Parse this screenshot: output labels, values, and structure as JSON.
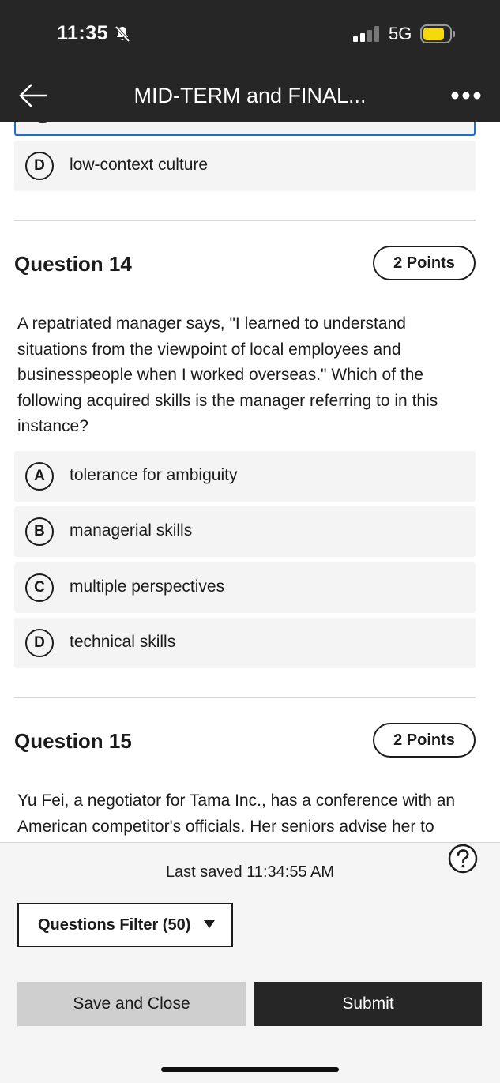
{
  "status_bar": {
    "time": "11:35",
    "network": "5G",
    "battery_color": "#f5d90a"
  },
  "header": {
    "title": "MID-TERM and FINAL...",
    "back_icon": "back-arrow-icon",
    "more_icon": "more-dots-icon"
  },
  "prev_question": {
    "options": [
      {
        "letter": "D",
        "text": "low-context culture"
      }
    ]
  },
  "question14": {
    "title": "Question 14",
    "points": "2 Points",
    "lines": [
      "A repatriated manager says, \"I learned to understand",
      "situations from the viewpoint of local employees and",
      "businesspeople when I worked overseas.\" Which of the",
      "following acquired skills is the manager referring to in this",
      "instance?"
    ],
    "options": [
      {
        "letter": "A",
        "text": "tolerance for ambiguity"
      },
      {
        "letter": "B",
        "text": "managerial skills"
      },
      {
        "letter": "C",
        "text": "multiple perspectives"
      },
      {
        "letter": "D",
        "text": "technical skills"
      }
    ]
  },
  "question15": {
    "title": "Question 15",
    "points": "2 Points",
    "lines": [
      "Yu Fei, a negotiator for Tama Inc., has a conference with an",
      "American competitor's officials. Her seniors advise her to"
    ]
  },
  "footer": {
    "last_saved": "Last saved 11:34:55 AM",
    "filter_label": "Questions Filter (50)",
    "save_close_label": "Save and Close",
    "submit_label": "Submit",
    "help_icon": "help-icon"
  }
}
